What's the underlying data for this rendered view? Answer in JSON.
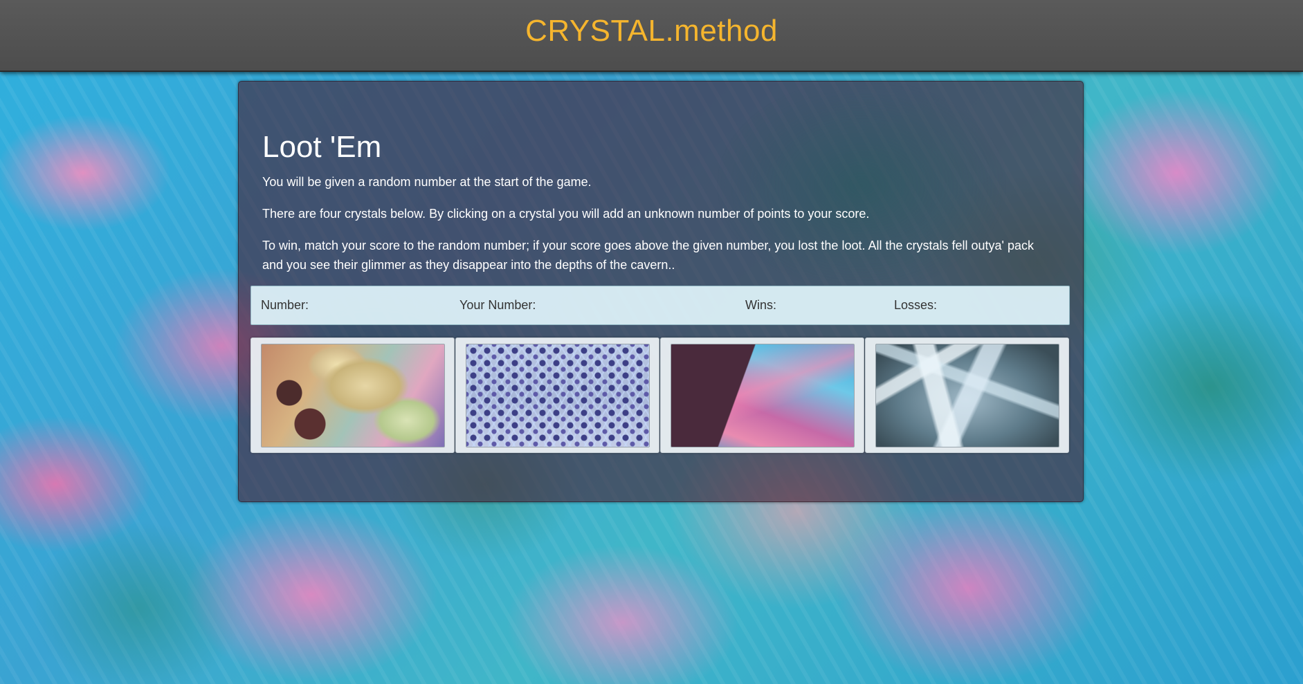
{
  "navbar": {
    "brand": "CRYSTAL.method",
    "brand_color": "#f5b52e"
  },
  "game": {
    "title": "Loot 'Em",
    "instructions": [
      "You will be given a random number at the start of the game.",
      "There are four crystals below. By clicking on a crystal you will add an unknown number of points to your score.",
      "To win, match your score to the random number; if your score goes above the given number, you lost the loot. All the crystals fell outya' pack and you see their glimmer as they disappear into the depths of the cavern.."
    ],
    "stats": {
      "number_label": "Number:",
      "number_value": "",
      "your_number_label": "Your Number:",
      "your_number_value": "",
      "wins_label": "Wins:",
      "wins_value": "",
      "losses_label": "Losses:",
      "losses_value": ""
    },
    "crystals": [
      {
        "name": "crystal-1",
        "icon": "amber-crystal-image"
      },
      {
        "name": "crystal-2",
        "icon": "lattice-crystal-image"
      },
      {
        "name": "crystal-3",
        "icon": "prism-crystal-image"
      },
      {
        "name": "crystal-4",
        "icon": "selenite-crystal-image"
      }
    ]
  },
  "colors": {
    "panel_bg": "rgba(70, 30, 50, 0.62)",
    "stats_bg": "#e1f5fc",
    "navbar_bg": "#555555",
    "page_bg": "#37a9d8"
  }
}
